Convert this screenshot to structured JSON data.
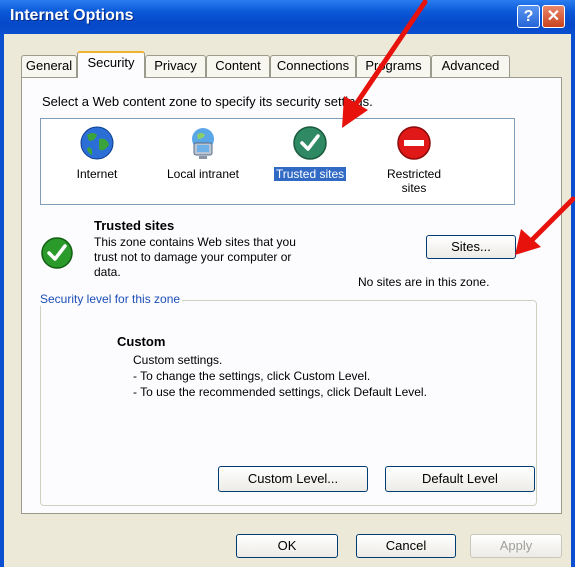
{
  "window": {
    "title": "Internet Options",
    "help_glyph": "?",
    "close_glyph": "✕"
  },
  "tabs": [
    {
      "label": "General"
    },
    {
      "label": "Security",
      "active": true
    },
    {
      "label": "Privacy"
    },
    {
      "label": "Content"
    },
    {
      "label": "Connections"
    },
    {
      "label": "Programs"
    },
    {
      "label": "Advanced"
    }
  ],
  "security": {
    "instruction": "Select a Web content zone to specify its security settings.",
    "zones": [
      {
        "label": "Internet",
        "icon": "globe-icon"
      },
      {
        "label": "Local intranet",
        "icon": "intranet-icon"
      },
      {
        "label": "Trusted sites",
        "icon": "trusted-check-icon",
        "selected": true
      },
      {
        "label_line1": "Restricted",
        "label_line2": "sites",
        "icon": "restricted-icon"
      }
    ],
    "zone_info": {
      "title": "Trusted sites",
      "desc_line1": "This zone contains Web sites that you",
      "desc_line2": "trust not to damage your computer or",
      "desc_line3": "data.",
      "sites_button": "Sites...",
      "sites_status": "No sites are in this zone."
    },
    "level_group": {
      "legend": "Security level for this zone",
      "level_name": "Custom",
      "line1": "Custom settings.",
      "line2": "- To change the settings, click Custom Level.",
      "line3": "- To use the recommended settings, click Default Level.",
      "custom_level_button": "Custom Level...",
      "default_level_button": "Default Level"
    }
  },
  "footer": {
    "ok": "OK",
    "cancel": "Cancel",
    "apply": "Apply"
  },
  "colors": {
    "annotation_arrow": "#e8120c",
    "title_bar": "#0a58d8",
    "selection": "#316ac5"
  }
}
